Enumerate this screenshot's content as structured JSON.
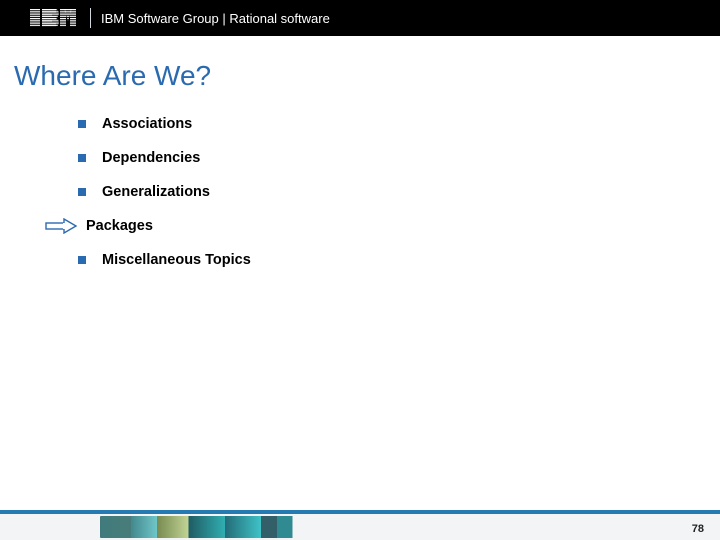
{
  "header": {
    "brand": "IBM",
    "text": "IBM Software Group | Rational software"
  },
  "title": "Where Are We?",
  "agenda": [
    {
      "label": "Associations",
      "current": false
    },
    {
      "label": "Dependencies",
      "current": false
    },
    {
      "label": "Generalizations",
      "current": false
    },
    {
      "label": "Packages",
      "current": true
    },
    {
      "label": "Miscellaneous Topics",
      "current": false
    }
  ],
  "footer": {
    "page_number": "78"
  },
  "colors": {
    "accent": "#2a6ab0",
    "footer_bar": "#267ab3"
  }
}
